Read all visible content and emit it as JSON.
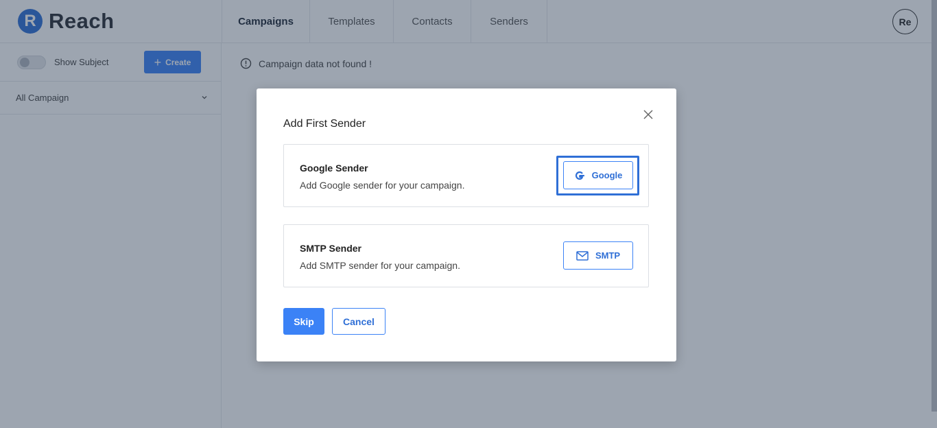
{
  "app": {
    "logo_letter": "R",
    "name": "Reach"
  },
  "nav": {
    "tabs": [
      {
        "label": "Campaigns",
        "active": true
      },
      {
        "label": "Templates",
        "active": false
      },
      {
        "label": "Contacts",
        "active": false
      },
      {
        "label": "Senders",
        "active": false
      }
    ]
  },
  "user": {
    "avatar_initials": "Re"
  },
  "sidebar": {
    "show_subject_label": "Show Subject",
    "show_subject_on": false,
    "create_label": "Create",
    "filter_label": "All Campaign"
  },
  "main": {
    "notice": "Campaign data not found !"
  },
  "modal": {
    "title": "Add First Sender",
    "google": {
      "title": "Google Sender",
      "description": "Add Google sender for your campaign.",
      "button_label": "Google"
    },
    "smtp": {
      "title": "SMTP Sender",
      "description": "Add SMTP sender for your campaign.",
      "button_label": "SMTP"
    },
    "skip_label": "Skip",
    "cancel_label": "Cancel"
  },
  "colors": {
    "accent": "#3b82f6",
    "brand": "#2f6fd6",
    "overlay": "#26374f"
  }
}
